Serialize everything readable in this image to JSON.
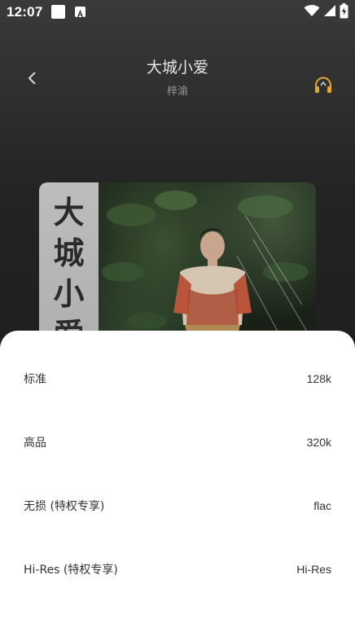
{
  "status_bar": {
    "time": "12:07",
    "icons": [
      "notification-square-icon",
      "app-a-icon",
      "wifi-icon",
      "signal-icon",
      "battery-icon"
    ]
  },
  "header": {
    "back_icon": "chevron-left-icon",
    "title": "大城小爱",
    "artist": "梓渝",
    "quality_icon": "headphones-icon"
  },
  "album": {
    "cover_text": [
      "大",
      "城",
      "小",
      "爱"
    ]
  },
  "quality_sheet": {
    "options": [
      {
        "label": "标准",
        "value": "128k"
      },
      {
        "label": "高品",
        "value": "320k"
      },
      {
        "label": "无损 (特权专享)",
        "value": "flac"
      },
      {
        "label": "Hi-Res (特权专享)",
        "value": "Hi-Res"
      }
    ]
  },
  "colors": {
    "accent_gold": "#e0a82e",
    "sheet_bg": "#ffffff",
    "text_dark": "#333333"
  }
}
